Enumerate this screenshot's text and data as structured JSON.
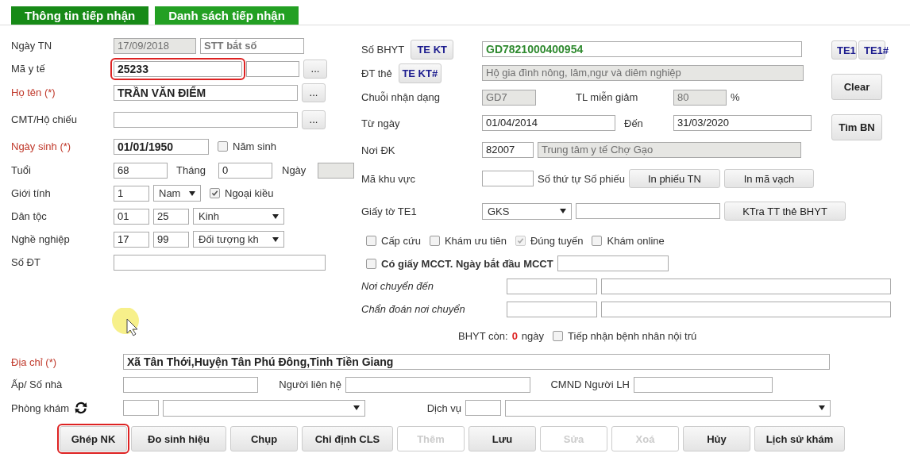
{
  "tabs": [
    {
      "label": "Thông tin tiếp nhận",
      "selected": true
    },
    {
      "label": "Danh sách tiếp nhận",
      "selected": false
    }
  ],
  "left_rows": [
    {
      "label": "Ngày TN",
      "required": false,
      "controls": [
        {
          "kind": "input",
          "value": "17/09/2018",
          "disabled": true
        },
        {
          "kind": "input",
          "placeholder": "STT bắt số"
        }
      ]
    },
    {
      "label": "Mã y tế",
      "required": false,
      "controls": [
        {
          "kind": "input",
          "value": "25233",
          "bold": true,
          "highlighted": true
        },
        {
          "kind": "input"
        },
        {
          "kind": "button",
          "label": "..."
        }
      ]
    },
    {
      "label": "Họ tên (*)",
      "required": true,
      "controls": [
        {
          "kind": "input",
          "value": "TRẦN VĂN ĐIỂM",
          "bold": true
        },
        {
          "kind": "button",
          "label": "..."
        }
      ]
    },
    {
      "label": "CMT/Hộ chiếu",
      "required": false,
      "controls": [
        {
          "kind": "input"
        },
        {
          "kind": "button",
          "label": "..."
        }
      ]
    },
    {
      "label": "Ngày sinh (*)",
      "required": true,
      "controls": [
        {
          "kind": "input",
          "value": "01/01/1950",
          "bold": true
        },
        {
          "kind": "checkbox",
          "label": "Năm sinh",
          "checked": false
        }
      ]
    },
    {
      "label": "Tuổi",
      "required": false,
      "controls": [
        {
          "kind": "input",
          "value": "68"
        },
        {
          "kind": "text",
          "text": "Tháng"
        },
        {
          "kind": "input",
          "value": "0"
        },
        {
          "kind": "text",
          "text": "Ngày"
        },
        {
          "kind": "input",
          "disabled": true
        }
      ]
    },
    {
      "label": "Giới tính",
      "required": false,
      "controls": [
        {
          "kind": "input",
          "value": "1"
        },
        {
          "kind": "select",
          "value": "Nam"
        },
        {
          "kind": "checkbox",
          "label": "Ngoại kiều",
          "checked": true
        }
      ]
    },
    {
      "label": "Dân tộc",
      "required": false,
      "controls": [
        {
          "kind": "input",
          "value": "01"
        },
        {
          "kind": "input",
          "value": "25"
        },
        {
          "kind": "select",
          "value": "Kinh"
        }
      ]
    },
    {
      "label": "Nghề nghiệp",
      "required": false,
      "controls": [
        {
          "kind": "input",
          "value": "17"
        },
        {
          "kind": "input",
          "value": "99"
        },
        {
          "kind": "select",
          "value": "Đối tượng kh"
        }
      ]
    },
    {
      "label": "Số ĐT",
      "required": false,
      "controls": [
        {
          "kind": "input"
        }
      ]
    }
  ],
  "right_rows": [
    {
      "label": "Số BHYT",
      "label_button": "TE KT",
      "controls": [
        {
          "kind": "input",
          "value": "GD7821000400954",
          "bold": true,
          "color": "#2f8a2f"
        }
      ]
    },
    {
      "label": "ĐT thẻ",
      "label_button": "TE KT#",
      "controls": [
        {
          "kind": "input",
          "value": "Hộ gia đình nông, lâm,ngư và diêm nghiệp",
          "disabled": true
        }
      ]
    },
    {
      "label": "Chuỗi nhận dạng",
      "controls": [
        {
          "kind": "input",
          "value": "GD7",
          "disabled": true
        },
        {
          "kind": "text",
          "text": "TL miễn giảm"
        },
        {
          "kind": "input",
          "value": "80",
          "disabled": true
        },
        {
          "kind": "text",
          "text": "%"
        }
      ]
    },
    {
      "label": "Từ ngày",
      "controls": [
        {
          "kind": "input",
          "value": "01/04/2014"
        },
        {
          "kind": "text",
          "text": "Đến"
        },
        {
          "kind": "input",
          "value": "31/03/2020"
        }
      ]
    },
    {
      "label": "Nơi ĐK",
      "controls": [
        {
          "kind": "input",
          "value": "82007"
        },
        {
          "kind": "input",
          "value": "Trung tâm y tế Chợ Gạo",
          "disabled": true
        }
      ]
    },
    {
      "label": "Mã khu vực",
      "controls": [
        {
          "kind": "input"
        },
        {
          "kind": "text",
          "text": "Số thứ tự Số phiếu"
        },
        {
          "kind": "button",
          "label": "In phiếu TN"
        },
        {
          "kind": "button",
          "label": "In mã vạch"
        }
      ]
    },
    {
      "label": "Giấy tờ TE1",
      "controls": [
        {
          "kind": "select",
          "value": "GKS"
        },
        {
          "kind": "input"
        },
        {
          "kind": "button",
          "label": "KTra TT thẻ BHYT"
        }
      ]
    }
  ],
  "side_buttons": [
    {
      "label": "TE1"
    },
    {
      "label": "TE1#"
    },
    {
      "label": "Clear"
    },
    {
      "label": "Tìm BN"
    }
  ],
  "right_lower_rows": [
    {
      "controls": [
        {
          "kind": "checkbox",
          "label": "Cấp cứu",
          "checked": false,
          "disabled": false
        },
        {
          "kind": "checkbox",
          "label": "Khám ưu tiên",
          "checked": false,
          "disabled": false
        },
        {
          "kind": "checkbox",
          "label": "Đúng tuyến",
          "checked": true,
          "disabled": true
        },
        {
          "kind": "checkbox",
          "label": "Khám online",
          "checked": false,
          "disabled": false
        }
      ]
    },
    {
      "controls": [
        {
          "kind": "checkbox",
          "label": "Có giấy MCCT. Ngày bắt đầu MCCT",
          "checked": false,
          "bold": true
        },
        {
          "kind": "input"
        }
      ]
    },
    {
      "label": "Nơi chuyển đến",
      "italic": true,
      "controls": [
        {
          "kind": "input"
        },
        {
          "kind": "input"
        }
      ]
    },
    {
      "label": "Chẩn đoán nơi chuyển",
      "italic": true,
      "controls": [
        {
          "kind": "input"
        },
        {
          "kind": "input"
        }
      ]
    },
    {
      "controls": [
        {
          "kind": "text",
          "text": "BHYT còn:"
        },
        {
          "kind": "count",
          "text": "0"
        },
        {
          "kind": "text",
          "text": "ngày"
        },
        {
          "kind": "checkbox",
          "label": "Tiếp nhận bệnh nhân nội trú",
          "checked": false
        }
      ]
    }
  ],
  "bottom_rows": [
    {
      "label": "Địa chỉ (*)",
      "required": true,
      "controls": [
        {
          "kind": "input",
          "value": "Xã Tân Thới,Huyện Tân Phú Đông,Tinh Tiền Giang",
          "bold": true
        }
      ]
    },
    {
      "label": "Ấp/ Số nhà",
      "required": false,
      "controls": [
        {
          "kind": "input"
        },
        {
          "kind": "text",
          "text": "Người liên hệ"
        },
        {
          "kind": "input"
        },
        {
          "kind": "text",
          "text": "CMND Người LH"
        },
        {
          "kind": "input"
        }
      ]
    },
    {
      "label": "Phòng khám",
      "required": false,
      "refresh": true,
      "controls": [
        {
          "kind": "input"
        },
        {
          "kind": "select"
        },
        {
          "kind": "text",
          "text": "Dịch vụ"
        },
        {
          "kind": "input"
        },
        {
          "kind": "select"
        }
      ]
    }
  ],
  "actions": [
    {
      "label": "Ghép NK",
      "disabled": false,
      "highlighted": true
    },
    {
      "label": "Đo sinh hiệu",
      "disabled": false,
      "highlighted": false
    },
    {
      "label": "Chụp",
      "disabled": false,
      "highlighted": false
    },
    {
      "label": "Chỉ định CLS",
      "disabled": false,
      "highlighted": false
    },
    {
      "label": "Thêm",
      "disabled": true,
      "highlighted": false
    },
    {
      "label": "Lưu",
      "disabled": false,
      "highlighted": false
    },
    {
      "label": "Sửa",
      "disabled": true,
      "highlighted": false
    },
    {
      "label": "Xoá",
      "disabled": true,
      "highlighted": false
    },
    {
      "label": "Hủy",
      "disabled": false,
      "highlighted": false
    },
    {
      "label": "Lịch sử khám",
      "disabled": false,
      "highlighted": false
    }
  ]
}
